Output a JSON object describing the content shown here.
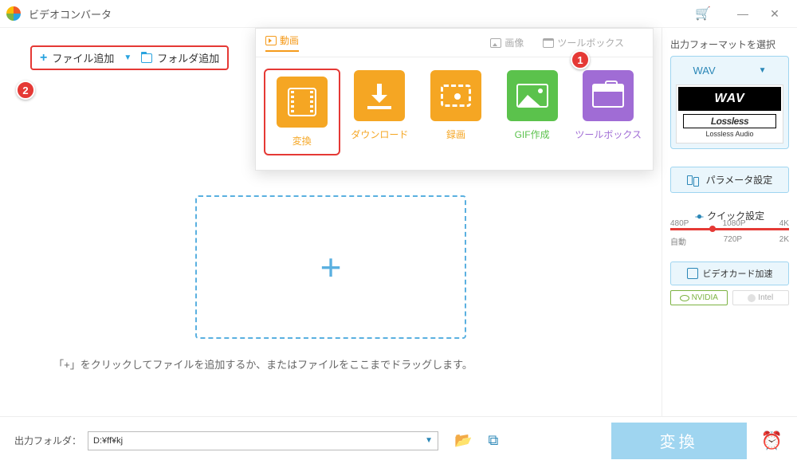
{
  "app": {
    "title": "ビデオコンバータ"
  },
  "addbar": {
    "add_file": "ファイル追加",
    "add_folder": "フォルダ追加"
  },
  "callouts": {
    "one": "1",
    "two": "2"
  },
  "category_tabs": {
    "video": "動画",
    "image": "画像",
    "toolbox": "ツールボックス"
  },
  "tiles": {
    "convert": "変換",
    "download": "ダウンロード",
    "record": "録画",
    "gif": "GIF作成",
    "toolbox": "ツールボックス"
  },
  "drop_hint": "「+」をクリックしてファイルを追加するか、またはファイルをここまでドラッグします。",
  "sidebar": {
    "format_title": "出力フォーマットを選択",
    "format_value": "WAV",
    "card": {
      "big": "WAV",
      "brand": "Lossless",
      "sub": "Lossless Audio"
    },
    "params_btn": "パラメータ設定",
    "quick_title": "クイック設定",
    "presets_top": [
      "480P",
      "1080P",
      "4K"
    ],
    "presets_bot": [
      "自動",
      "720P",
      "2K"
    ],
    "gpu_btn": "ビデオカード加速",
    "vendors": [
      "NVIDIA",
      "Intel"
    ]
  },
  "bottom": {
    "label": "出力フォルダ：",
    "path": "D:¥ff¥kj",
    "convert": "変換"
  }
}
